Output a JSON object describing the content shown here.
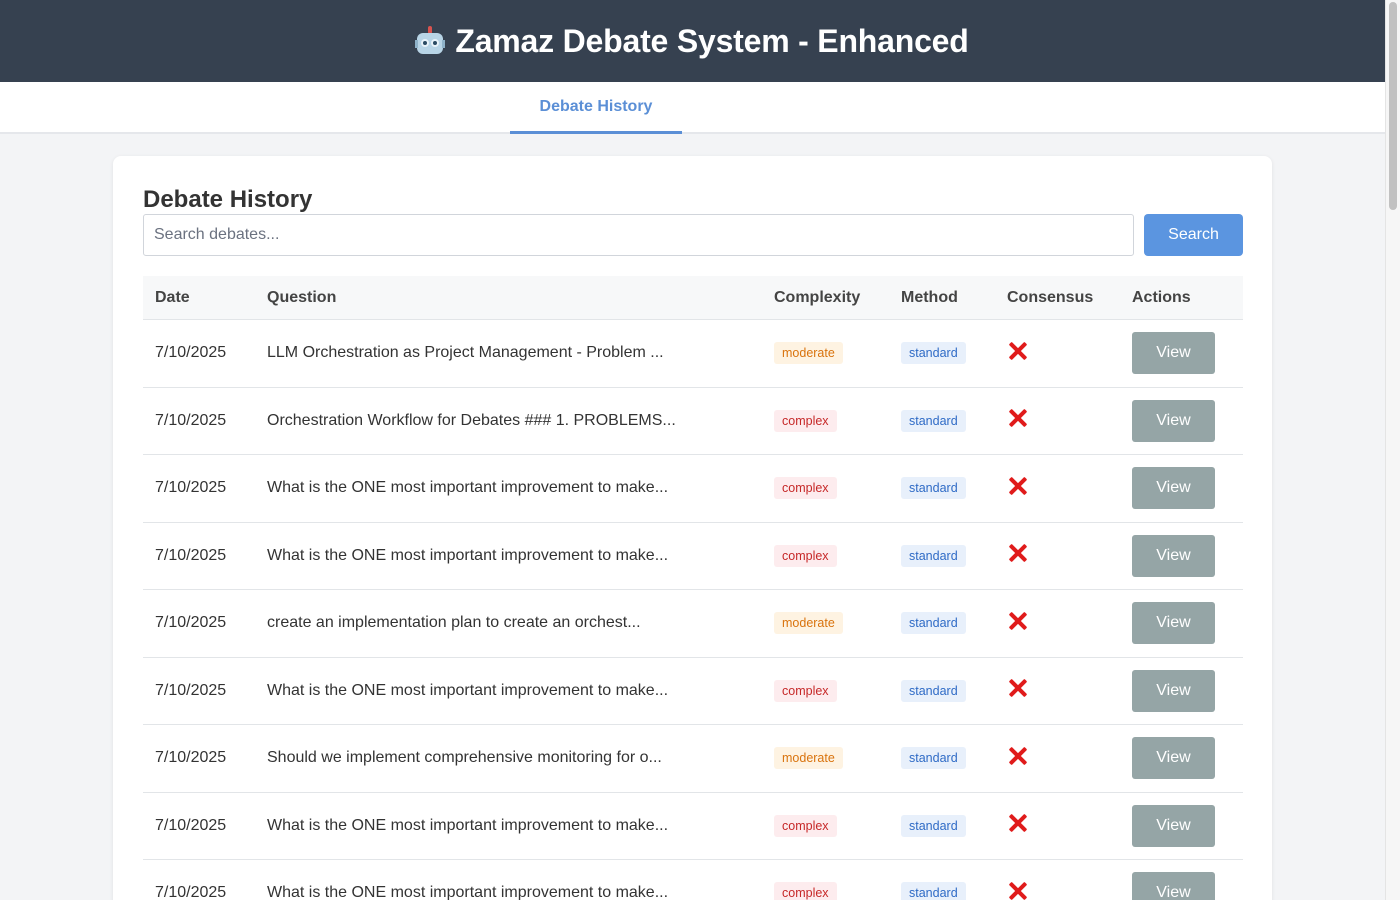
{
  "app": {
    "title": "Zamaz Debate System - Enhanced",
    "icon": "robot-icon"
  },
  "tabs": [
    {
      "label": "Debate History",
      "active": true
    }
  ],
  "history": {
    "title": "Debate History",
    "search_placeholder": "Search debates...",
    "search_value": "",
    "search_button": "Search",
    "columns": [
      "Date",
      "Question",
      "Complexity",
      "Method",
      "Consensus",
      "Actions"
    ],
    "rows": [
      {
        "date": "7/10/2025",
        "question": "LLM Orchestration as Project Management - Problem ...",
        "complexity": "moderate",
        "method": "standard",
        "consensus": "cross-icon",
        "action": "View"
      },
      {
        "date": "7/10/2025",
        "question": "Orchestration Workflow for Debates ### 1. PROBLEMS...",
        "complexity": "complex",
        "method": "standard",
        "consensus": "cross-icon",
        "action": "View"
      },
      {
        "date": "7/10/2025",
        "question": "What is the ONE most important improvement to make...",
        "complexity": "complex",
        "method": "standard",
        "consensus": "cross-icon",
        "action": "View"
      },
      {
        "date": "7/10/2025",
        "question": "What is the ONE most important improvement to make...",
        "complexity": "complex",
        "method": "standard",
        "consensus": "cross-icon",
        "action": "View"
      },
      {
        "date": "7/10/2025",
        "question": "create an implementation plan to create an orchest...",
        "complexity": "moderate",
        "method": "standard",
        "consensus": "cross-icon",
        "action": "View"
      },
      {
        "date": "7/10/2025",
        "question": "What is the ONE most important improvement to make...",
        "complexity": "complex",
        "method": "standard",
        "consensus": "cross-icon",
        "action": "View"
      },
      {
        "date": "7/10/2025",
        "question": "Should we implement comprehensive monitoring for o...",
        "complexity": "moderate",
        "method": "standard",
        "consensus": "cross-icon",
        "action": "View"
      },
      {
        "date": "7/10/2025",
        "question": "What is the ONE most important improvement to make...",
        "complexity": "complex",
        "method": "standard",
        "consensus": "cross-icon",
        "action": "View"
      },
      {
        "date": "7/10/2025",
        "question": "What is the ONE most important improvement to make...",
        "complexity": "complex",
        "method": "standard",
        "consensus": "cross-icon",
        "action": "View"
      }
    ]
  },
  "colors": {
    "header_bg": "#364150",
    "accent": "#5b95e0",
    "view_button": "#95a5a6",
    "consensus_false": "#e01b1b"
  }
}
